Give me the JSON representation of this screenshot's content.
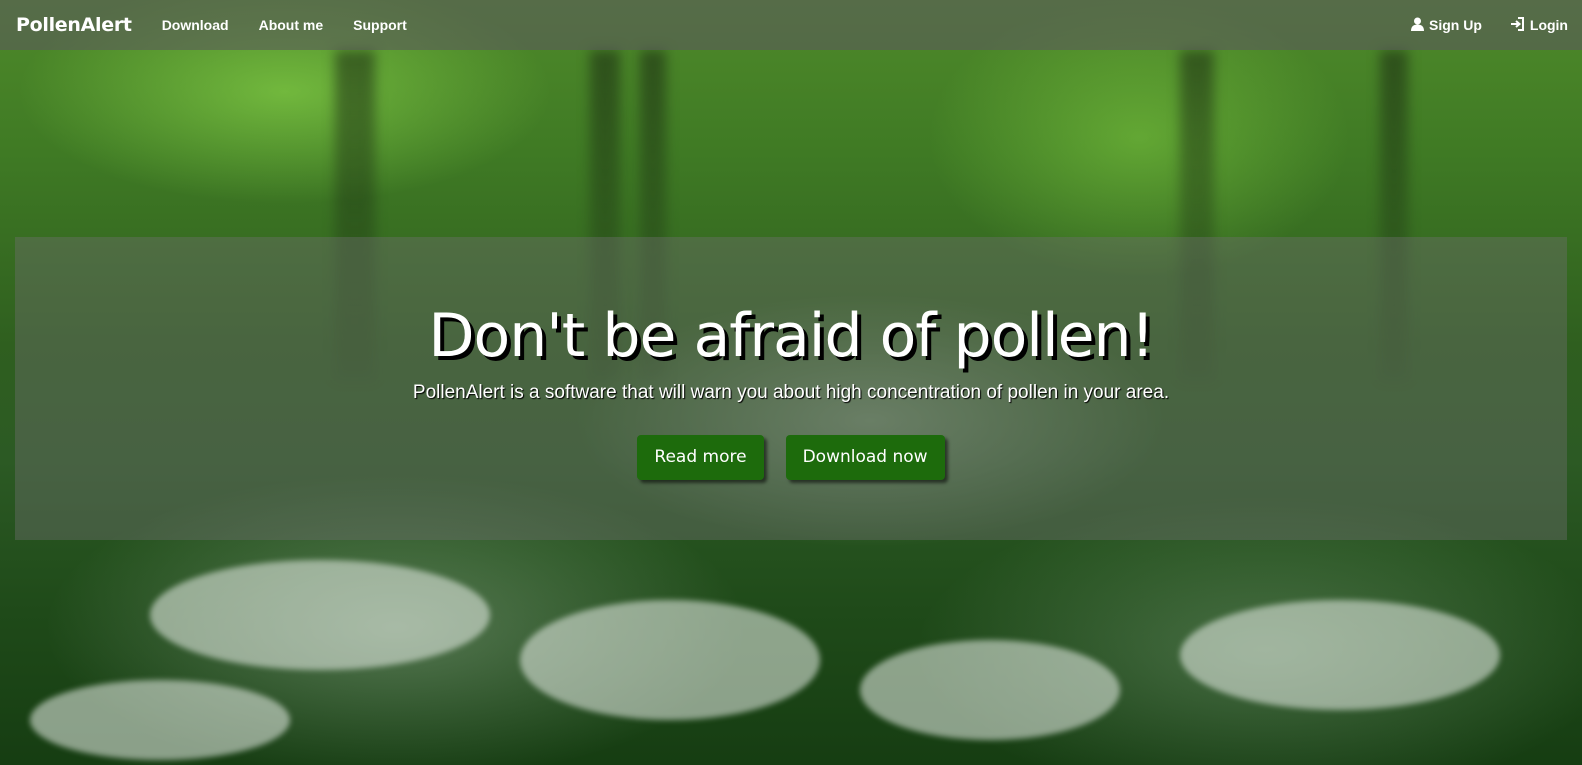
{
  "navbar": {
    "brand": "PollenAlert",
    "links": [
      {
        "label": "Download"
      },
      {
        "label": "About me"
      },
      {
        "label": "Support"
      }
    ],
    "right_links": [
      {
        "label": "Sign Up",
        "icon": "user-icon"
      },
      {
        "label": "Login",
        "icon": "login-icon"
      }
    ]
  },
  "hero": {
    "title": "Don't be afraid of pollen!",
    "subtitle": "PollenAlert is a software that will warn you about high concentration of pollen in your area.",
    "buttons": [
      {
        "label": "Read more"
      },
      {
        "label": "Download now"
      }
    ]
  },
  "colors": {
    "button_bg": "#1d6b0c",
    "navbar_bg": "rgba(90,90,90,0.62)",
    "text": "#ffffff"
  }
}
